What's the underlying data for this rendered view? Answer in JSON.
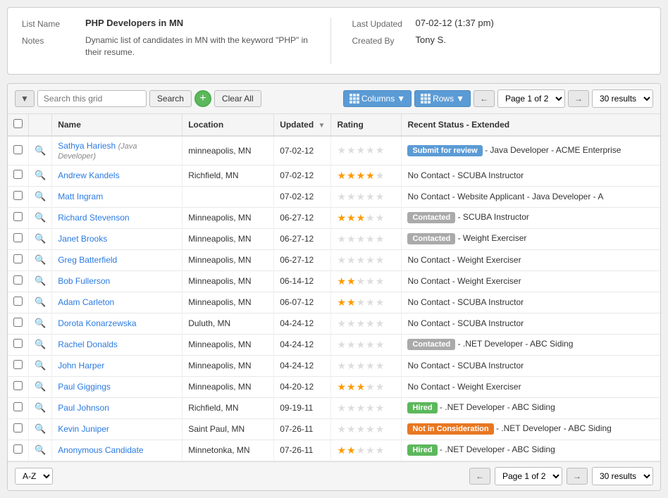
{
  "info": {
    "list_name_label": "List Name",
    "list_name_value": "PHP Developers in MN",
    "notes_label": "Notes",
    "notes_value": "Dynamic list of candidates in MN with the keyword \"PHP\" in their resume.",
    "last_updated_label": "Last Updated",
    "last_updated_value": "07-02-12 (1:37 pm)",
    "created_by_label": "Created By",
    "created_by_value": "Tony S."
  },
  "toolbar": {
    "search_placeholder": "Search this grid",
    "search_btn": "Search",
    "clear_btn": "Clear All",
    "columns_btn": "Columns",
    "rows_btn": "Rows",
    "page_label": "Page 1 of 2",
    "results_label": "30 results"
  },
  "table": {
    "columns": [
      "",
      "",
      "Name",
      "Location",
      "Updated",
      "Rating",
      "Recent Status - Extended"
    ],
    "rows": [
      {
        "name": "Sathya Hariesh",
        "name_sub": "(Java Developer)",
        "location": "minneapolis, MN",
        "updated": "07-02-12",
        "rating": 0,
        "status_badge": "Submit for review",
        "status_badge_type": "submit",
        "status_text": "- Java Developer - ACME Enterprise"
      },
      {
        "name": "Andrew Kandels",
        "name_sub": "",
        "location": "Richfield, MN",
        "updated": "07-02-12",
        "rating": 4,
        "status_badge": "",
        "status_badge_type": "",
        "status_text": "No Contact - SCUBA Instructor"
      },
      {
        "name": "Matt Ingram",
        "name_sub": "",
        "location": "",
        "updated": "07-02-12",
        "rating": 0,
        "status_badge": "",
        "status_badge_type": "",
        "status_text": "No Contact - Website Applicant - Java Developer - A"
      },
      {
        "name": "Richard Stevenson",
        "name_sub": "",
        "location": "Minneapolis, MN",
        "updated": "06-27-12",
        "rating": 3,
        "status_badge": "Contacted",
        "status_badge_type": "contacted",
        "status_text": "- SCUBA Instructor"
      },
      {
        "name": "Janet Brooks",
        "name_sub": "",
        "location": "Minneapolis, MN",
        "updated": "06-27-12",
        "rating": 0,
        "status_badge": "Contacted",
        "status_badge_type": "contacted",
        "status_text": "- Weight Exerciser"
      },
      {
        "name": "Greg Batterfield",
        "name_sub": "",
        "location": "Minneapolis, MN",
        "updated": "06-27-12",
        "rating": 0,
        "status_badge": "",
        "status_badge_type": "",
        "status_text": "No Contact - Weight Exerciser"
      },
      {
        "name": "Bob Fullerson",
        "name_sub": "",
        "location": "Minneapolis, MN",
        "updated": "06-14-12",
        "rating": 2,
        "status_badge": "",
        "status_badge_type": "",
        "status_text": "No Contact - Weight Exerciser"
      },
      {
        "name": "Adam Carleton",
        "name_sub": "",
        "location": "Minneapolis, MN",
        "updated": "06-07-12",
        "rating": 2,
        "status_badge": "",
        "status_badge_type": "",
        "status_text": "No Contact - SCUBA Instructor"
      },
      {
        "name": "Dorota Konarzewska",
        "name_sub": "",
        "location": "Duluth, MN",
        "updated": "04-24-12",
        "rating": 0,
        "status_badge": "",
        "status_badge_type": "",
        "status_text": "No Contact - SCUBA Instructor"
      },
      {
        "name": "Rachel Donalds",
        "name_sub": "",
        "location": "Minneapolis, MN",
        "updated": "04-24-12",
        "rating": 0,
        "status_badge": "Contacted",
        "status_badge_type": "contacted",
        "status_text": "- .NET Developer - ABC Siding"
      },
      {
        "name": "John Harper",
        "name_sub": "",
        "location": "Minneapolis, MN",
        "updated": "04-24-12",
        "rating": 0,
        "status_badge": "",
        "status_badge_type": "",
        "status_text": "No Contact - SCUBA Instructor"
      },
      {
        "name": "Paul Giggings",
        "name_sub": "",
        "location": "Minneapolis, MN",
        "updated": "04-20-12",
        "rating": 3,
        "status_badge": "",
        "status_badge_type": "",
        "status_text": "No Contact - Weight Exerciser"
      },
      {
        "name": "Paul Johnson",
        "name_sub": "",
        "location": "Richfield, MN",
        "updated": "09-19-11",
        "rating": 0,
        "status_badge": "Hired",
        "status_badge_type": "hired",
        "status_text": "- .NET Developer - ABC Siding"
      },
      {
        "name": "Kevin Juniper",
        "name_sub": "",
        "location": "Saint Paul, MN",
        "updated": "07-26-11",
        "rating": 0,
        "status_badge": "Not in Consideration",
        "status_badge_type": "not-considered",
        "status_text": "- .NET Developer - ABC Siding"
      },
      {
        "name": "Anonymous Candidate",
        "name_sub": "",
        "location": "Minnetonka, MN",
        "updated": "07-26-11",
        "rating": 2,
        "status_badge": "Hired",
        "status_badge_type": "hired",
        "status_text": "- .NET Developer - ABC Siding"
      }
    ]
  },
  "bottom": {
    "sort_options": [
      "A-Z"
    ],
    "page_label": "Page 1 of 2",
    "results_label": "30 results"
  }
}
